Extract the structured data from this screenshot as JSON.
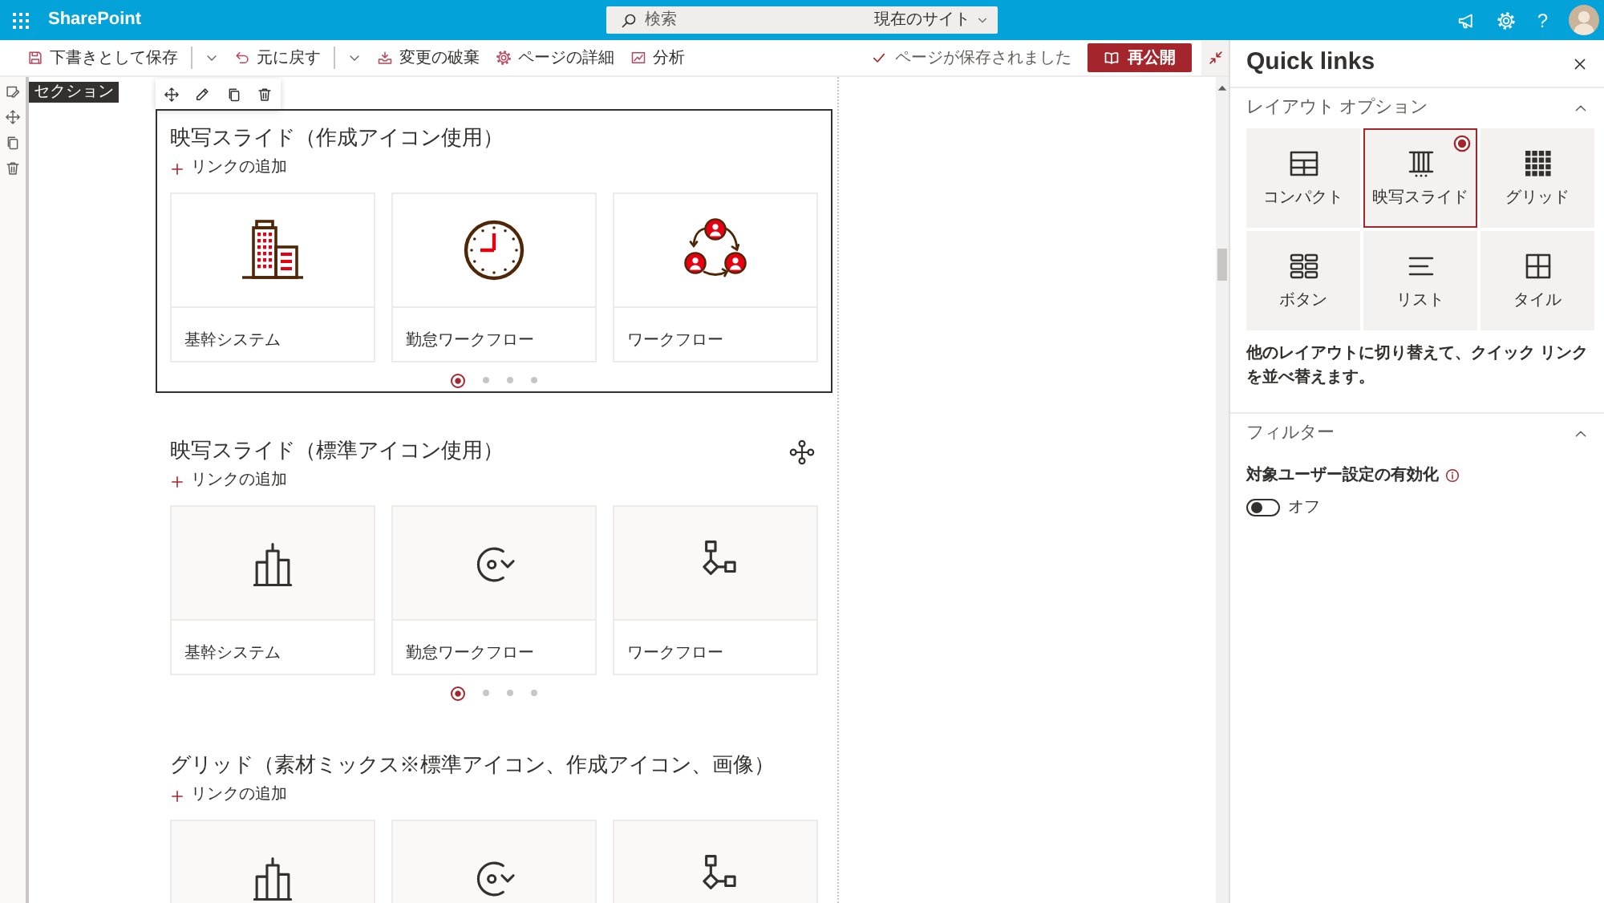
{
  "app_bar": {
    "brand": "SharePoint",
    "search": {
      "placeholder": "検索",
      "scope": "現在のサイト"
    },
    "help": "?"
  },
  "command_bar": {
    "commands": [
      {
        "label": "下書きとして保存",
        "has_menu": true
      },
      {
        "label": "元に戻す",
        "has_menu": true
      },
      {
        "label": "変更の破棄",
        "has_menu": false
      },
      {
        "label": "ページの詳細",
        "has_menu": false
      },
      {
        "label": "分析",
        "has_menu": false
      }
    ],
    "status": "ページが保存されました",
    "publish_button": "再公開"
  },
  "canvas": {
    "section_tag": "セクション",
    "web_parts": [
      {
        "title": "映写スライド（作成アイコン使用）",
        "selected": true,
        "hovered": false,
        "add_link": "リンクの追加",
        "links": [
          {
            "label": "基幹システム",
            "kind": "custom"
          },
          {
            "label": "勤怠ワークフロー",
            "kind": "custom"
          },
          {
            "label": "ワークフロー",
            "kind": "custom"
          }
        ],
        "pager": [
          {
            "selected": true
          },
          {
            "selected": false
          },
          {
            "selected": false
          },
          {
            "selected": false
          }
        ]
      },
      {
        "title": "映写スライド（標準アイコン使用）",
        "selected": false,
        "hovered": true,
        "add_link": "リンクの追加",
        "links": [
          {
            "label": "基幹システム",
            "kind": "standard"
          },
          {
            "label": "勤怠ワークフロー",
            "kind": "standard"
          },
          {
            "label": "ワークフロー",
            "kind": "standard"
          }
        ],
        "pager": [
          {
            "selected": true
          },
          {
            "selected": false
          },
          {
            "selected": false
          },
          {
            "selected": false
          }
        ]
      },
      {
        "title": "グリッド（素材ミックス※標準アイコン、作成アイコン、画像）",
        "selected": false,
        "hovered": false,
        "add_link": "リンクの追加",
        "links": [
          {
            "kind": "standard"
          },
          {
            "kind": "standard"
          },
          {
            "kind": "standard"
          }
        ]
      }
    ]
  },
  "panel": {
    "title": "Quick links",
    "groups": [
      {
        "kind": "layouts",
        "title": "レイアウト オプション",
        "expanded": true,
        "options": [
          {
            "label": "コンパクト",
            "selected": false
          },
          {
            "label": "映写スライド",
            "selected": true
          },
          {
            "label": "グリッド",
            "selected": false
          },
          {
            "label": "ボタン",
            "selected": false
          },
          {
            "label": "リスト",
            "selected": false
          },
          {
            "label": "タイル",
            "selected": false
          }
        ],
        "description": "他のレイアウトに切り替えて、クイック リンクを並べ替えます。"
      },
      {
        "kind": "filter",
        "title": "フィルター",
        "expanded": true,
        "setting": "対象ユーザー設定の有効化",
        "toggle": {
          "on": false,
          "label": "オフ"
        }
      }
    ]
  }
}
